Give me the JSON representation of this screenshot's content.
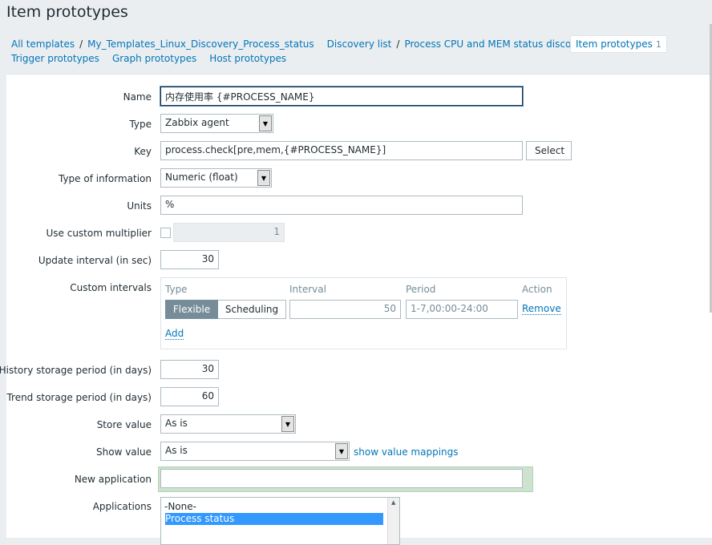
{
  "page": {
    "title": "Item prototypes"
  },
  "breadcrumb": {
    "all_templates": "All templates",
    "template": "My_Templates_Linux_Discovery_Process_status",
    "discovery_list": "Discovery list",
    "discovery_rule": "Process CPU and MEM status discovery",
    "item_prototypes": "Item prototypes",
    "item_prototypes_count": "1",
    "trigger_prototypes": "Trigger prototypes",
    "graph_prototypes": "Graph prototypes",
    "host_prototypes": "Host prototypes",
    "separator": "/"
  },
  "form": {
    "name": {
      "label": "Name",
      "value": "内存使用率 {#PROCESS_NAME}"
    },
    "type": {
      "label": "Type",
      "value": "Zabbix agent"
    },
    "key": {
      "label": "Key",
      "value": "process.check[pre,mem,{#PROCESS_NAME}]",
      "button": "Select"
    },
    "type_of_information": {
      "label": "Type of information",
      "value": "Numeric (float)"
    },
    "units": {
      "label": "Units",
      "value": "%"
    },
    "custom_multiplier": {
      "label": "Use custom multiplier",
      "checked": false,
      "value": "1"
    },
    "update_interval": {
      "label": "Update interval (in sec)",
      "value": "30"
    },
    "custom_intervals": {
      "label": "Custom intervals",
      "headers": {
        "type": "Type",
        "interval": "Interval",
        "period": "Period",
        "action": "Action"
      },
      "row": {
        "flexible": "Flexible",
        "scheduling": "Scheduling",
        "interval": "50",
        "period": "1-7,00:00-24:00",
        "remove": "Remove"
      },
      "add": "Add"
    },
    "history": {
      "label": "History storage period (in days)",
      "value": "30"
    },
    "trend": {
      "label": "Trend storage period (in days)",
      "value": "60"
    },
    "store_value": {
      "label": "Store value",
      "value": "As is"
    },
    "show_value": {
      "label": "Show value",
      "value": "As is",
      "link": "show value mappings"
    },
    "new_application": {
      "label": "New application",
      "value": ""
    },
    "applications": {
      "label": "Applications",
      "options": [
        "-None-",
        "Process status"
      ],
      "selected": "Process status"
    }
  },
  "colors": {
    "link": "#0275b8",
    "background": "#ebeef0",
    "selected_toggle": "#768d99",
    "selected_option": "#3399ff"
  }
}
